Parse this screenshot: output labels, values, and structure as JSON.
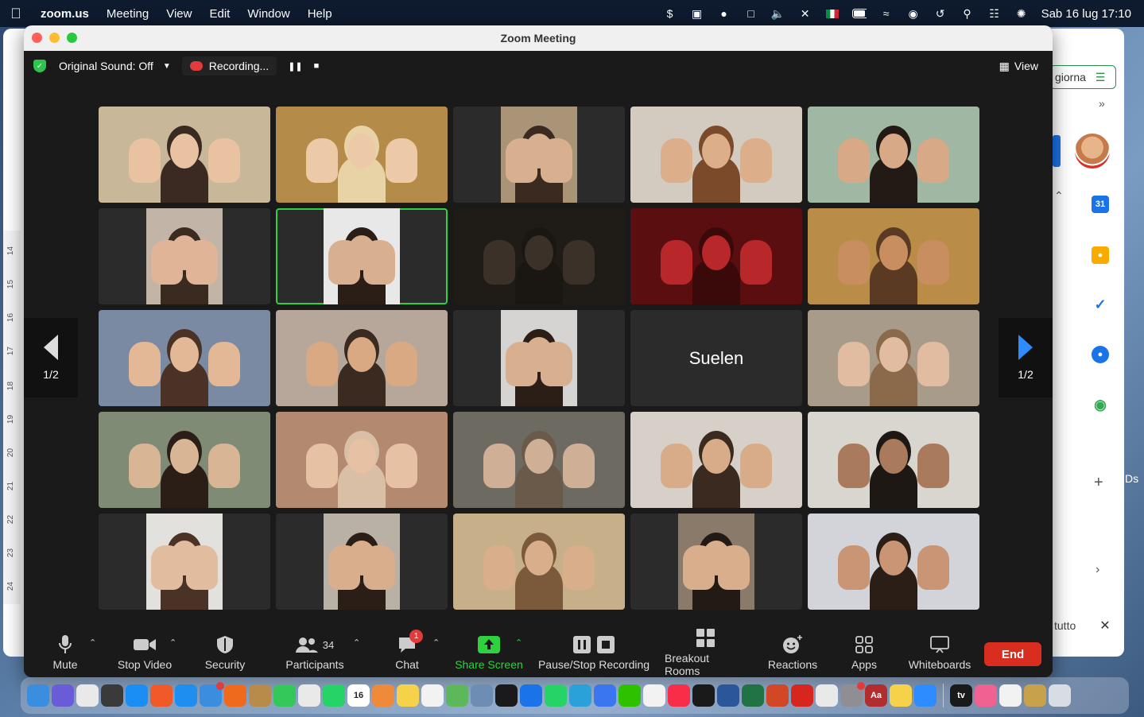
{
  "menubar": {
    "app": "zoom.us",
    "items": [
      "Meeting",
      "View",
      "Edit",
      "Window",
      "Help"
    ],
    "datetime": "Sab 16 lug  17:10"
  },
  "background_app": {
    "search_fragment": "giorna",
    "bottom_fragment": "tutto",
    "outside_text": "Ds",
    "ruler": [
      "14",
      "15",
      "16",
      "17",
      "18",
      "19",
      "20",
      "21",
      "22",
      "23",
      "24"
    ]
  },
  "window": {
    "title": "Zoom Meeting"
  },
  "topbar": {
    "original_sound": "Original Sound: Off",
    "recording": "Recording...",
    "view": "View"
  },
  "pager": {
    "left": "1/2",
    "right": "1/2"
  },
  "tiles": [
    {
      "bg": "#c9b79a",
      "skin": "#e9c3a1",
      "hair": "#3a2a22"
    },
    {
      "bg": "#b58b4a",
      "skin": "#eccaa8",
      "hair": "#e7d3a6"
    },
    {
      "bg": "#2b2b2b",
      "inner": "#a99478",
      "skin": "#d9b08f",
      "hair": "#3a2a1f"
    },
    {
      "bg": "#d3cbc0",
      "skin": "#dcae8a",
      "hair": "#7a4a2b"
    },
    {
      "bg": "#9fb7a3",
      "skin": "#d8a986",
      "hair": "#231a15"
    },
    {
      "bg": "#2b2b2b",
      "inner": "#c2b4a6",
      "skin": "#e0b497",
      "hair": "#3a2a1f"
    },
    {
      "bg": "#2b2b2b",
      "inner": "#e8e8e8",
      "skin": "#d9b08f",
      "hair": "#2a1e17",
      "active": true
    },
    {
      "bg": "#1f1c18",
      "skin": "#3b3128",
      "hair": "#1a1612"
    },
    {
      "bg": "#5a0e10",
      "skin": "#b8282a",
      "hair": "#3a0a0b"
    },
    {
      "bg": "#b98c48",
      "skin": "#c98e60",
      "hair": "#5a3a22"
    },
    {
      "bg": "#7b8aa3",
      "skin": "#e2b896",
      "hair": "#4a3326"
    },
    {
      "bg": "#b7a79a",
      "skin": "#d9a983",
      "hair": "#3a2a1f"
    },
    {
      "bg": "#2b2b2b",
      "inner": "#d6d4d2",
      "skin": "#d9b08f",
      "hair": "#2a1e17"
    },
    {
      "bg": "#2b2b2b",
      "name": "Suelen"
    },
    {
      "bg": "#a99b8a",
      "skin": "#e2bca0",
      "hair": "#8a6a4a"
    },
    {
      "bg": "#7f8b74",
      "skin": "#d7b595",
      "hair": "#2a1e17"
    },
    {
      "bg": "#b38a70",
      "skin": "#e6c1a3",
      "hair": "#d9bfa6"
    },
    {
      "bg": "#6d6a62",
      "skin": "#cfb096",
      "hair": "#6a5a4a"
    },
    {
      "bg": "#d6d0c8",
      "skin": "#d8ac88",
      "hair": "#3a2a1f"
    },
    {
      "bg": "#d8d6cf",
      "skin": "#a97a5c",
      "hair": "#1e1814"
    },
    {
      "bg": "#2b2b2b",
      "inner": "#e3e1de",
      "skin": "#e2bc9e",
      "hair": "#4a3326"
    },
    {
      "bg": "#2b2b2b",
      "inner": "#b9b0a6",
      "skin": "#d9ae8c",
      "hair": "#2a1e17"
    },
    {
      "bg": "#c7b089",
      "skin": "#d9ae8a",
      "hair": "#7a5a3a"
    },
    {
      "bg": "#2b2b2b",
      "inner": "#8a7a6a",
      "skin": "#d9ae8c",
      "hair": "#231a15"
    },
    {
      "bg": "#d3d4da",
      "skin": "#c99575",
      "hair": "#2a1e17"
    }
  ],
  "toolbar": {
    "mute": "Mute",
    "stop_video": "Stop Video",
    "security": "Security",
    "participants": "Participants",
    "participants_count": "34",
    "chat": "Chat",
    "chat_badge": "1",
    "share_screen": "Share Screen",
    "pause_stop_recording": "Pause/Stop Recording",
    "breakout_rooms": "Breakout Rooms",
    "reactions": "Reactions",
    "apps": "Apps",
    "whiteboards": "Whiteboards",
    "end": "End"
  },
  "colors": {
    "accent_green": "#2ed13e",
    "end_red": "#d92d20",
    "arrow_blue": "#2d8cff"
  },
  "dock": {
    "calendar_day": "16",
    "apple_tv": "tv",
    "dictionary": "Aa",
    "apps": [
      {
        "name": "finder-icon",
        "color": "#3b8de0"
      },
      {
        "name": "siri-icon",
        "color": "#6a5bd8"
      },
      {
        "name": "launchpad-icon",
        "color": "#e9e9e9"
      },
      {
        "name": "calculator-icon",
        "color": "#3a3a3a"
      },
      {
        "name": "app-store-icon",
        "color": "#1b8ef5"
      },
      {
        "name": "brave-icon",
        "color": "#f05a28"
      },
      {
        "name": "safari-icon",
        "color": "#1f8ef1"
      },
      {
        "name": "mail-icon",
        "color": "#3b8de0",
        "badge": true
      },
      {
        "name": "firefox-icon",
        "color": "#f06a1d"
      },
      {
        "name": "notes-app-icon",
        "color": "#b88b4a"
      },
      {
        "name": "messages-icon",
        "color": "#34c759"
      },
      {
        "name": "slack-icon",
        "color": "#e9e9e9"
      },
      {
        "name": "whatsapp-business-icon",
        "color": "#25d366"
      },
      {
        "name": "calendar-icon",
        "color": "#ffffff"
      },
      {
        "name": "photos-app-icon",
        "color": "#f08a3b"
      },
      {
        "name": "notes-icon",
        "color": "#f6d24a"
      },
      {
        "name": "reminders-icon",
        "color": "#f2f2f2"
      },
      {
        "name": "maps-icon",
        "color": "#5db85c"
      },
      {
        "name": "preview-icon",
        "color": "#6e8db5"
      },
      {
        "name": "binance-icon",
        "color": "#1a1a1a"
      },
      {
        "name": "shazam-icon",
        "color": "#1a73e8"
      },
      {
        "name": "whatsapp-icon",
        "color": "#25d366"
      },
      {
        "name": "telegram-icon",
        "color": "#2aa1d8"
      },
      {
        "name": "signal-icon",
        "color": "#3a76f0"
      },
      {
        "name": "wechat-icon",
        "color": "#2dc100"
      },
      {
        "name": "photos-icon",
        "color": "#f2f2f2"
      },
      {
        "name": "music-icon",
        "color": "#fa2d48"
      },
      {
        "name": "monitor-icon",
        "color": "#1a1a1a"
      },
      {
        "name": "word-icon",
        "color": "#2b579a"
      },
      {
        "name": "excel-icon",
        "color": "#217346"
      },
      {
        "name": "powerpoint-icon",
        "color": "#d24726"
      },
      {
        "name": "acrobat-icon",
        "color": "#d7261e"
      },
      {
        "name": "yoga-icon",
        "color": "#e9e9e9"
      },
      {
        "name": "system-preferences-icon",
        "color": "#8e8e93",
        "badge": true
      },
      {
        "name": "dictionary-icon",
        "color": "#b22e2e"
      },
      {
        "name": "stickies-icon",
        "color": "#f6d24a"
      },
      {
        "name": "zoom-icon",
        "color": "#2d8cff"
      }
    ],
    "apps_right": [
      {
        "name": "apple-tv-icon",
        "color": "#1a1a1a"
      },
      {
        "name": "books-icon",
        "color": "#f06292"
      },
      {
        "name": "textedit-icon",
        "color": "#f2f2f2"
      },
      {
        "name": "downloads-icon",
        "color": "#c7a24a"
      },
      {
        "name": "trash-icon",
        "color": "#d8dde3"
      }
    ]
  }
}
